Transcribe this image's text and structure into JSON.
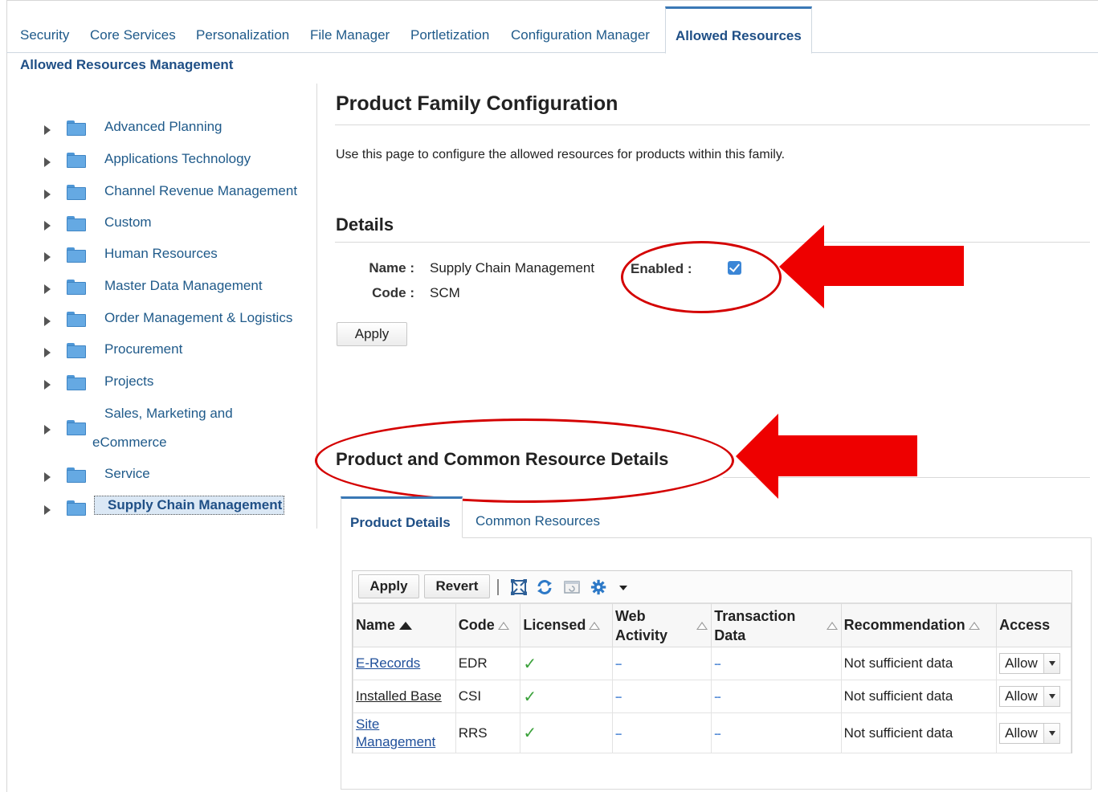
{
  "top_tabs": [
    "Security",
    "Core Services",
    "Personalization",
    "File Manager",
    "Portletization",
    "Configuration Manager",
    "Allowed Resources"
  ],
  "active_tab": "Allowed Resources",
  "section_title": "Allowed Resources Management",
  "tree": {
    "items": [
      {
        "label": "Advanced Planning"
      },
      {
        "label": "Applications Technology"
      },
      {
        "label": "Channel Revenue Management"
      },
      {
        "label": "Custom"
      },
      {
        "label": "Human Resources"
      },
      {
        "label": "Master Data Management"
      },
      {
        "label": "Order Management & Logistics"
      },
      {
        "label": "Procurement"
      },
      {
        "label": "Projects"
      },
      {
        "label_line1": "Sales, Marketing and",
        "label_line2": "eCommerce"
      },
      {
        "label": "Service"
      },
      {
        "label": "Supply Chain Management",
        "selected": true
      }
    ]
  },
  "page_title": "Product Family Configuration",
  "intro_text": "Use this page to configure the allowed resources for products within this family.",
  "details": {
    "heading": "Details",
    "name_label": "Name :",
    "name_value": "Supply Chain Management",
    "code_label": "Code :",
    "code_value": "SCM",
    "enabled_label": "Enabled :",
    "enabled": true,
    "apply_label": "Apply"
  },
  "resources": {
    "heading": "Product and Common Resource Details",
    "tabs": [
      "Product Details",
      "Common Resources"
    ],
    "active_tab": "Product Details",
    "toolbar": {
      "apply_label": "Apply",
      "revert_label": "Revert"
    },
    "columns": [
      "Name",
      "Code",
      "Licensed",
      "Web Activity",
      "Transaction Data",
      "Recommendation",
      "Access"
    ],
    "column_lines": {
      "web": [
        "Web",
        "Activity"
      ],
      "transaction": [
        "Transaction",
        "Data"
      ]
    },
    "rows": [
      {
        "name": "E-Records",
        "code": "EDR",
        "licensed": true,
        "web": "--",
        "transaction": "--",
        "recommendation": "Not sufficient data",
        "access": "Allow"
      },
      {
        "name": "Installed Base",
        "code": "CSI",
        "licensed": true,
        "web": "--",
        "transaction": "--",
        "recommendation": "Not sufficient data",
        "access": "Allow"
      },
      {
        "name_line1": "Site",
        "name_line2": "Management",
        "code": "RRS",
        "licensed": true,
        "web": "--",
        "transaction": "--",
        "recommendation": "Not sufficient data",
        "access": "Allow"
      }
    ]
  },
  "colors": {
    "accent": "#1f4f86",
    "link": "#1f5a8a",
    "annotation": "#d40000",
    "check": "#3aa13a"
  }
}
